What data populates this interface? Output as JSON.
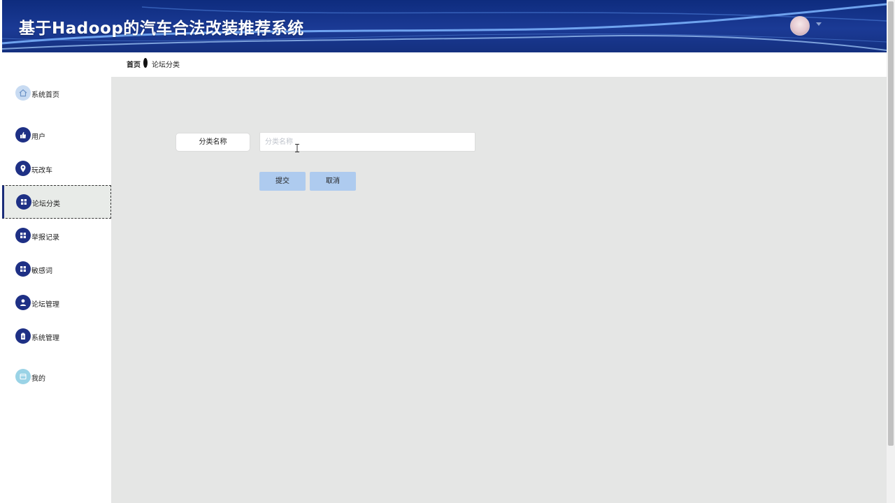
{
  "header": {
    "title": "基于Hadoop的汽车合法改装推荐系统",
    "avatar_icon": "user-avatar",
    "caret_icon": "caret-down-icon"
  },
  "breadcrumb": {
    "home": "首页",
    "current": "论坛分类"
  },
  "sidebar": {
    "items": [
      {
        "label": "系统首页",
        "icon": "home-icon"
      },
      {
        "label": "用户",
        "icon": "user-thumb-icon"
      },
      {
        "label": "玩改车",
        "icon": "location-pin-icon"
      },
      {
        "label": "论坛分类",
        "icon": "grid-icon",
        "active": true
      },
      {
        "label": "举报记录",
        "icon": "grid-icon"
      },
      {
        "label": "敏感词",
        "icon": "grid-icon"
      },
      {
        "label": "论坛管理",
        "icon": "person-icon"
      },
      {
        "label": "系统管理",
        "icon": "clipboard-icon"
      },
      {
        "label": "我的",
        "icon": "window-icon"
      }
    ]
  },
  "form": {
    "field_label": "分类名称",
    "field_placeholder": "分类名称",
    "field_value": "",
    "submit_label": "提交",
    "cancel_label": "取消"
  },
  "colors": {
    "header_blue": "#1b3a95",
    "nav_icon_blue": "#1e3085",
    "button_blue": "#aecbef",
    "content_bg": "#e5e6e5"
  }
}
